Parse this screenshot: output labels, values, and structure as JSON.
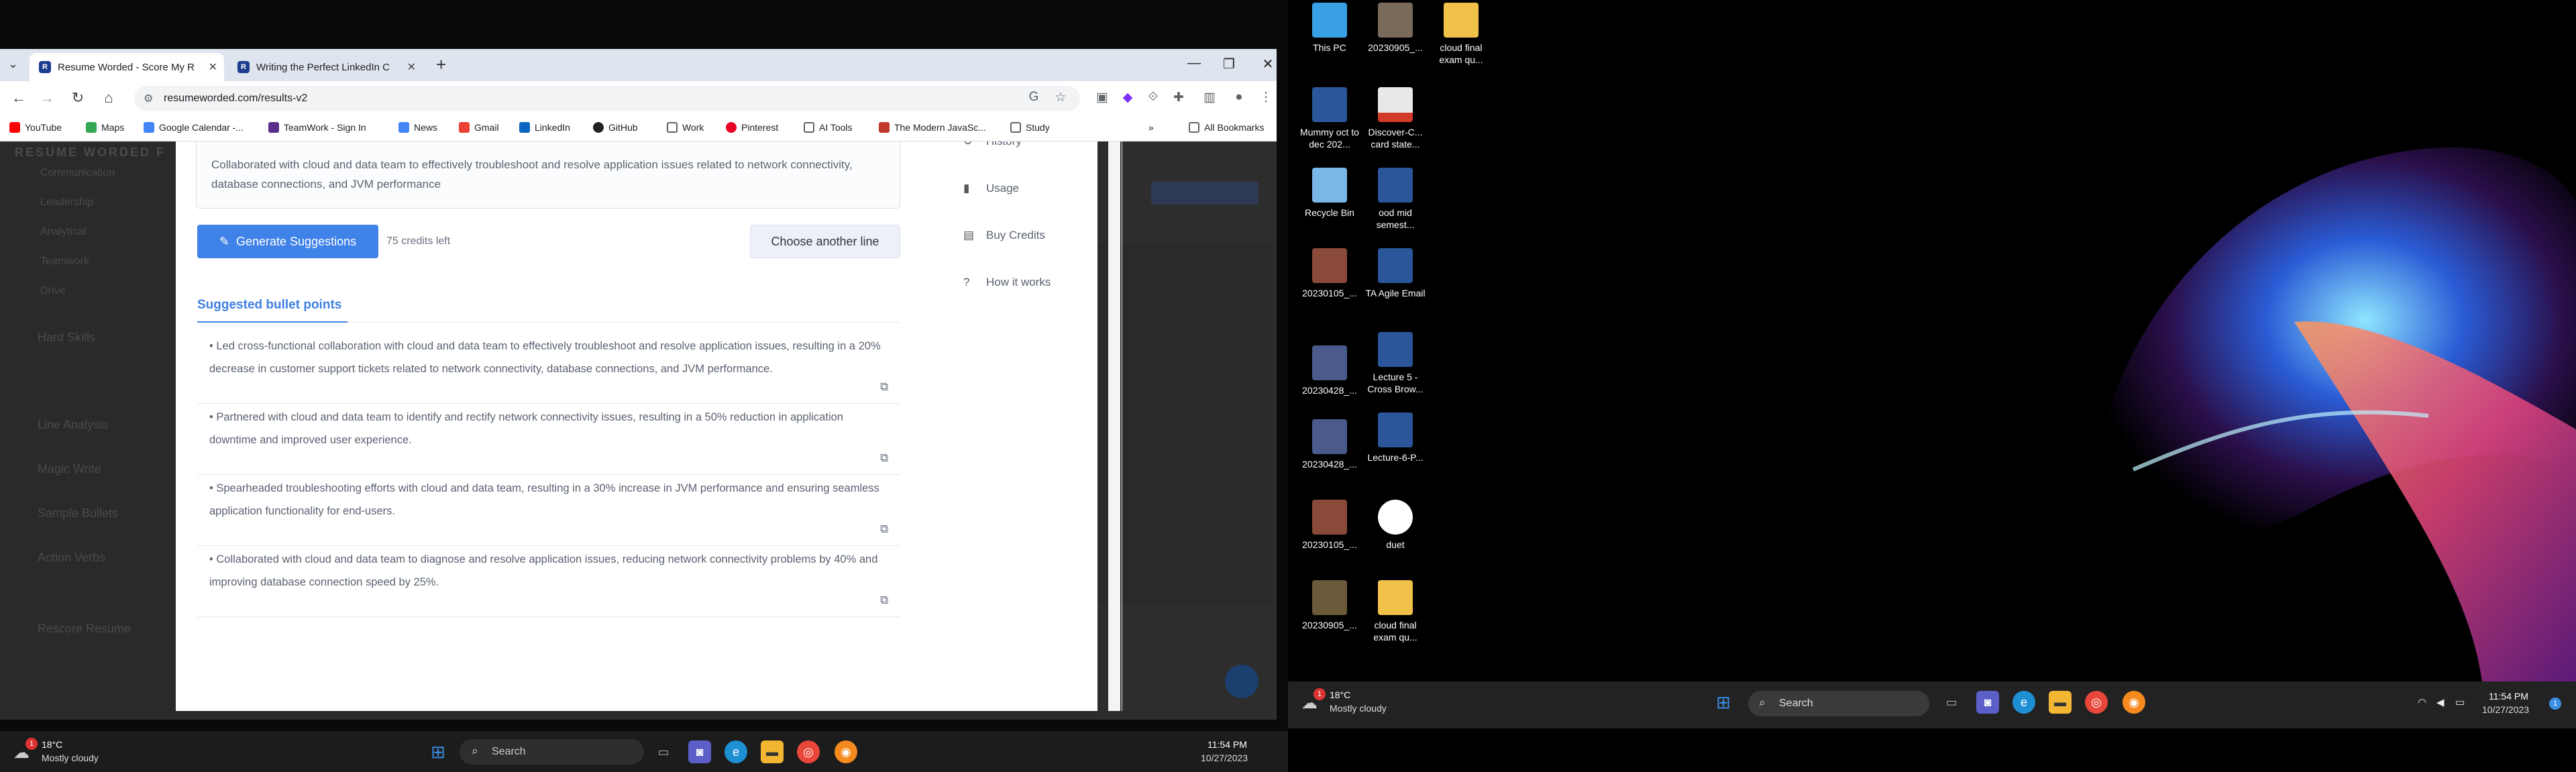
{
  "browser": {
    "tabs": [
      {
        "label": "Resume Worded - Score My R",
        "active": true
      },
      {
        "label": "Writing the Perfect LinkedIn C",
        "active": false
      }
    ],
    "url": "resumeworded.com/results-v2",
    "bookmarks": [
      "YouTube",
      "Maps",
      "Google Calendar -...",
      "TeamWork - Sign In",
      "News",
      "Gmail",
      "LinkedIn",
      "GitHub",
      "Work",
      "Pinterest",
      "AI Tools",
      "The Modern JavaSc...",
      "Study"
    ],
    "all_bookmarks": "All Bookmarks"
  },
  "background_app": {
    "brand": "RESUME WORDED F",
    "sidebar": [
      "Communication",
      "Leadership",
      "Analytical",
      "Teamwork",
      "Drive",
      "Hard Skills",
      "Line Analysis",
      "Magic Write",
      "Sample Bullets",
      "Action Verbs",
      "Rescore Resume"
    ]
  },
  "modal": {
    "original_line": "Collaborated with cloud and data team to effectively troubleshoot and resolve application issues related to network connectivity, database connections, and JVM performance",
    "generate_button": "Generate Suggestions",
    "credits": "75 credits left",
    "choose_button": "Choose another line",
    "suggested_title": "Suggested bullet points",
    "suggestions": [
      "• Led cross-functional collaboration with cloud and data team to effectively troubleshoot and resolve application issues, resulting in a 20% decrease in customer support tickets related to network connectivity, database connections, and JVM performance.",
      "• Partnered with cloud and data team to identify and rectify network connectivity issues, resulting in a 50% reduction in application downtime and improved user experience.",
      "• Spearheaded troubleshooting efforts with cloud and data team, resulting in a 30% increase in JVM performance and ensuring seamless application functionality for end-users.",
      "• Collaborated with cloud and data team to diagnose and resolve application issues, reducing network connectivity problems by 40% and improving database connection speed by 25%."
    ],
    "menu": [
      "History",
      "Usage",
      "Buy Credits",
      "How it works"
    ]
  },
  "taskbar_left": {
    "weather_temp": "18°C",
    "weather_desc": "Mostly cloudy",
    "search": "Search",
    "time": "11:54 PM",
    "date": "10/27/2023",
    "badge": "1"
  },
  "desktop": {
    "icons": [
      "This PC",
      "20230905_...",
      "cloud final exam qu...",
      "Mummy oct to dec 202...",
      "Discover-C... card state...",
      "Recycle Bin",
      "ood mid semest...",
      "20230105_...",
      "TA Agile Email",
      "20230428_...",
      "Lecture 5 - Cross Brow...",
      "20230428_...",
      "Lecture-6-P...",
      "20230105_...",
      "duet",
      "20230905_...",
      "cloud final exam qu..."
    ]
  },
  "taskbar_right": {
    "weather_temp": "18°C",
    "weather_desc": "Mostly cloudy",
    "search": "Search",
    "time": "11:54 PM",
    "date": "10/27/2023",
    "badge": "1"
  }
}
